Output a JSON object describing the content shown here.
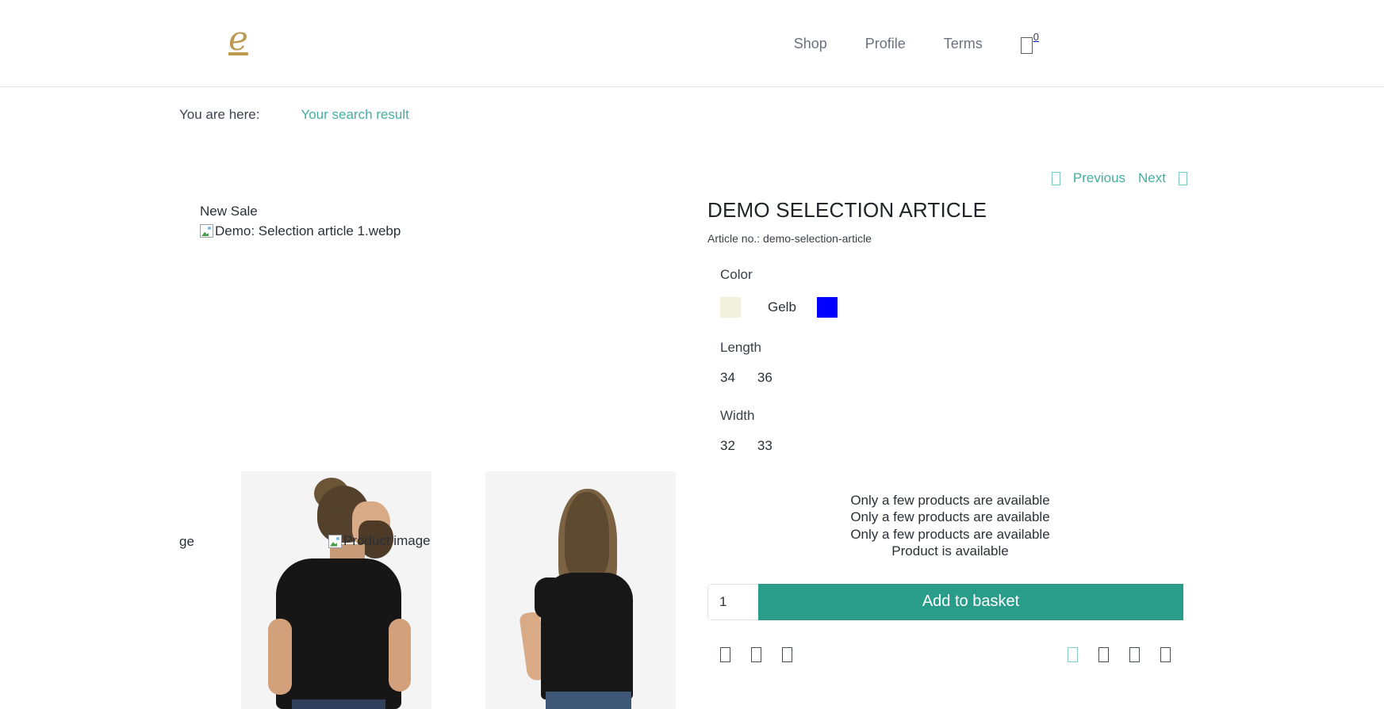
{
  "header": {
    "logo_text": "e",
    "logo_color": "#bd9a52",
    "nav": [
      {
        "label": "Shop",
        "name": "nav-link-shop"
      },
      {
        "label": "Profile",
        "name": "nav-link-profile"
      },
      {
        "label": "Terms",
        "name": "nav-link-terms"
      }
    ],
    "cart": {
      "icon": "shopping-cart-icon",
      "count": "0"
    }
  },
  "breadcrumb": {
    "label": "You are here:",
    "link": "Your search result",
    "link_color": "#43b0a0"
  },
  "pager": {
    "prev_icon": "chevron-left-icon",
    "prev": "Previous",
    "next": "Next",
    "next_icon": "chevron-right-icon"
  },
  "gallery": {
    "sale_badge": "New Sale",
    "main_image_alt": "Demo: Selection article 1.webp",
    "main_image_icon": "broken-image-icon",
    "thumb_caption": "Product image",
    "thumb_caption_icon": "broken-image-icon",
    "clipped_text": "ge",
    "thumbnails": [
      {
        "alt": "Product image",
        "subject": "man-black-tshirt-back"
      },
      {
        "alt": "Product image",
        "subject": "woman-black-tshirt-back"
      }
    ]
  },
  "product": {
    "title": "DEMO SELECTION ARTICLE",
    "article_no": "Article no.: demo-selection-article",
    "variants": [
      {
        "label": "Color",
        "type": "color",
        "options": [
          {
            "value": "",
            "swatch": "#f1f1dd",
            "name": "color-swatch-cream"
          },
          {
            "value": "Gelb",
            "swatch": null,
            "name": "color-option-gelb"
          },
          {
            "value": "",
            "swatch": "#0000ff",
            "name": "color-swatch-blue"
          }
        ]
      },
      {
        "label": "Length",
        "type": "size",
        "options": [
          {
            "value": "34",
            "name": "length-option-34"
          },
          {
            "value": "36",
            "name": "length-option-36"
          }
        ]
      },
      {
        "label": "Width",
        "type": "size",
        "options": [
          {
            "value": "32",
            "name": "width-option-32"
          },
          {
            "value": "33",
            "name": "width-option-33"
          }
        ]
      }
    ],
    "availability": [
      "Only a few products are available",
      "Only a few products are available",
      "Only a few products are available",
      "Product is available"
    ],
    "quantity": "1",
    "quantity_placeholder": "1",
    "add_to_basket_label": "Add to basket",
    "accent_color": "#2a9d8a"
  },
  "action_icons": {
    "left": [
      {
        "name": "wishlist-icon"
      },
      {
        "name": "compare-icon"
      },
      {
        "name": "print-icon"
      }
    ],
    "right": [
      {
        "name": "share-facebook-icon"
      },
      {
        "name": "share-twitter-icon"
      },
      {
        "name": "share-pinterest-icon"
      },
      {
        "name": "share-email-icon"
      }
    ]
  }
}
